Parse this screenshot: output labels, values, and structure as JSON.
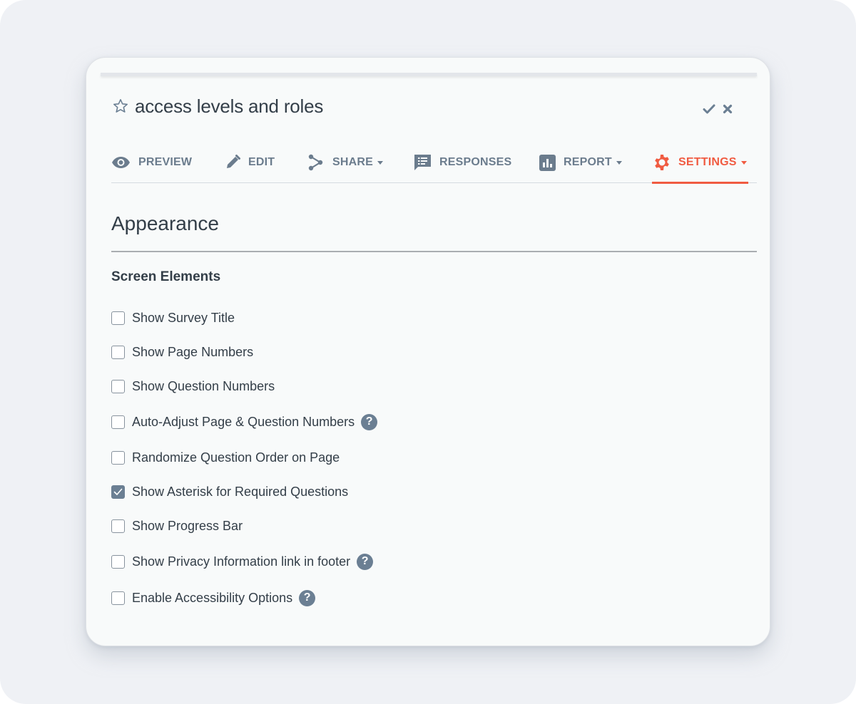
{
  "survey": {
    "title": "access levels and roles",
    "favorite": false
  },
  "title_actions": {
    "confirm_icon": "check-icon",
    "cancel_icon": "close-icon"
  },
  "tabs": [
    {
      "label": "PREVIEW",
      "icon": "eye-icon",
      "dropdown": false,
      "active": false
    },
    {
      "label": "EDIT",
      "icon": "pencil-icon",
      "dropdown": false,
      "active": false
    },
    {
      "label": "SHARE",
      "icon": "share-icon",
      "dropdown": true,
      "active": false
    },
    {
      "label": "RESPONSES",
      "icon": "responses-icon",
      "dropdown": false,
      "active": false
    },
    {
      "label": "REPORT",
      "icon": "bar-chart-icon",
      "dropdown": true,
      "active": false
    },
    {
      "label": "SETTINGS",
      "icon": "gear-icon",
      "dropdown": true,
      "active": true
    }
  ],
  "colors": {
    "accent": "#f05b41",
    "tab_inactive": "#6b7c8d",
    "text": "#333e48",
    "checkbox_checked": "#6b7f93"
  },
  "section": {
    "title": "Appearance",
    "group_title": "Screen Elements",
    "options": [
      {
        "label": "Show Survey Title",
        "checked": false,
        "help": false
      },
      {
        "label": "Show Page Numbers",
        "checked": false,
        "help": false
      },
      {
        "label": "Show Question Numbers",
        "checked": false,
        "help": false
      },
      {
        "label": "Auto-Adjust Page & Question Numbers",
        "checked": false,
        "help": true
      },
      {
        "label": "Randomize Question Order on Page",
        "checked": false,
        "help": false
      },
      {
        "label": "Show Asterisk for Required Questions",
        "checked": true,
        "help": false
      },
      {
        "label": "Show Progress Bar",
        "checked": false,
        "help": false
      },
      {
        "label": "Show Privacy Information link in footer",
        "checked": false,
        "help": true
      },
      {
        "label": "Enable Accessibility Options",
        "checked": false,
        "help": true
      }
    ],
    "help_glyph": "?"
  }
}
